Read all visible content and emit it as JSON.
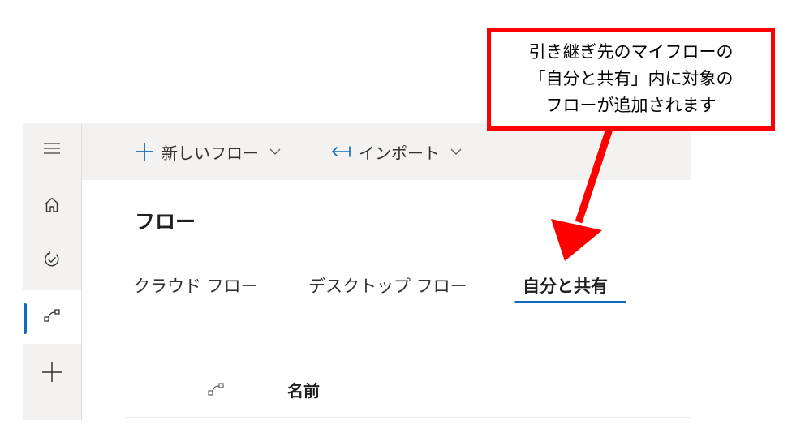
{
  "rail": {
    "items": [
      {
        "name": "menu",
        "icon": "hamburger-icon"
      },
      {
        "name": "home",
        "icon": "home-icon"
      },
      {
        "name": "approvals",
        "icon": "approvals-icon"
      },
      {
        "name": "my-flows",
        "icon": "flow-icon",
        "selected": true
      },
      {
        "name": "create",
        "icon": "plus-icon"
      }
    ]
  },
  "toolbar": {
    "new_flow_label": "新しいフロー",
    "import_label": "インポート"
  },
  "main": {
    "title": "フロー",
    "tabs": [
      {
        "label": "クラウド フロー",
        "selected": false
      },
      {
        "label": "デスクトップ フロー",
        "selected": false
      },
      {
        "label": "自分と共有",
        "selected": true
      }
    ],
    "table": {
      "columns": [
        "名前"
      ]
    }
  },
  "annotation": {
    "lines": [
      "引き継ぎ先のマイフローの",
      "「自分と共有」内に対象の",
      "フローが追加されます"
    ]
  },
  "colors": {
    "accent": "#0f6cbd",
    "rail_bg": "#f3f2f1",
    "annotation_red": "#ff0000"
  }
}
